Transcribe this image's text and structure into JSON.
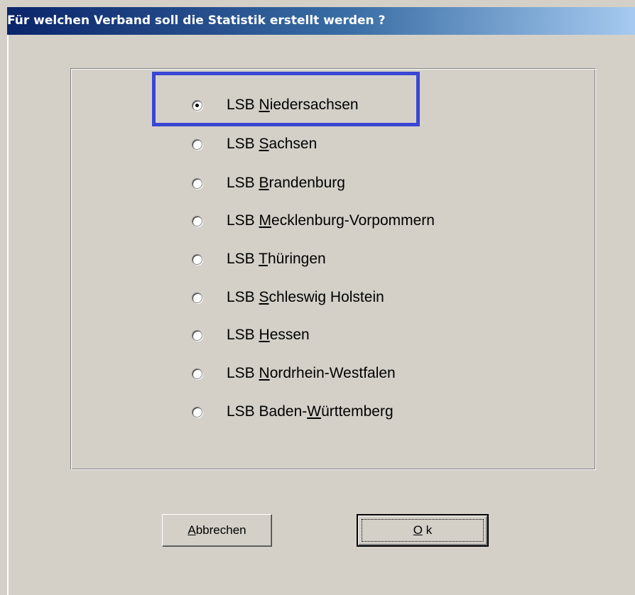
{
  "dialog": {
    "title": "Für welchen Verband soll die Statistik erstellt werden ?"
  },
  "options": [
    {
      "prefix": "LSB ",
      "accel": "N",
      "rest": "iedersachsen",
      "selected": true
    },
    {
      "prefix": "LSB ",
      "accel": "S",
      "rest": "achsen",
      "selected": false
    },
    {
      "prefix": "LSB ",
      "accel": "B",
      "rest": "randenburg",
      "selected": false
    },
    {
      "prefix": "LSB ",
      "accel": "M",
      "rest": "ecklenburg-Vorpommern",
      "selected": false
    },
    {
      "prefix": "LSB ",
      "accel": "T",
      "rest": "hüringen",
      "selected": false
    },
    {
      "prefix": "LSB ",
      "accel": "S",
      "rest": "chleswig Holstein",
      "selected": false
    },
    {
      "prefix": "LSB ",
      "accel": "H",
      "rest": "essen",
      "selected": false
    },
    {
      "prefix": "LSB ",
      "accel": "N",
      "rest": "ordrhein-Westfalen",
      "selected": false
    },
    {
      "prefix": "LSB Baden-",
      "accel": "W",
      "rest": "ürttemberg",
      "selected": false
    }
  ],
  "buttons": {
    "cancel": {
      "accel": "A",
      "rest": "bbrechen"
    },
    "ok": {
      "accel": "O",
      "rest": " k"
    }
  },
  "colors": {
    "highlight_box": "#3a46d4",
    "title_gradient_start": "#0a246a",
    "title_gradient_end": "#a6caf0"
  }
}
